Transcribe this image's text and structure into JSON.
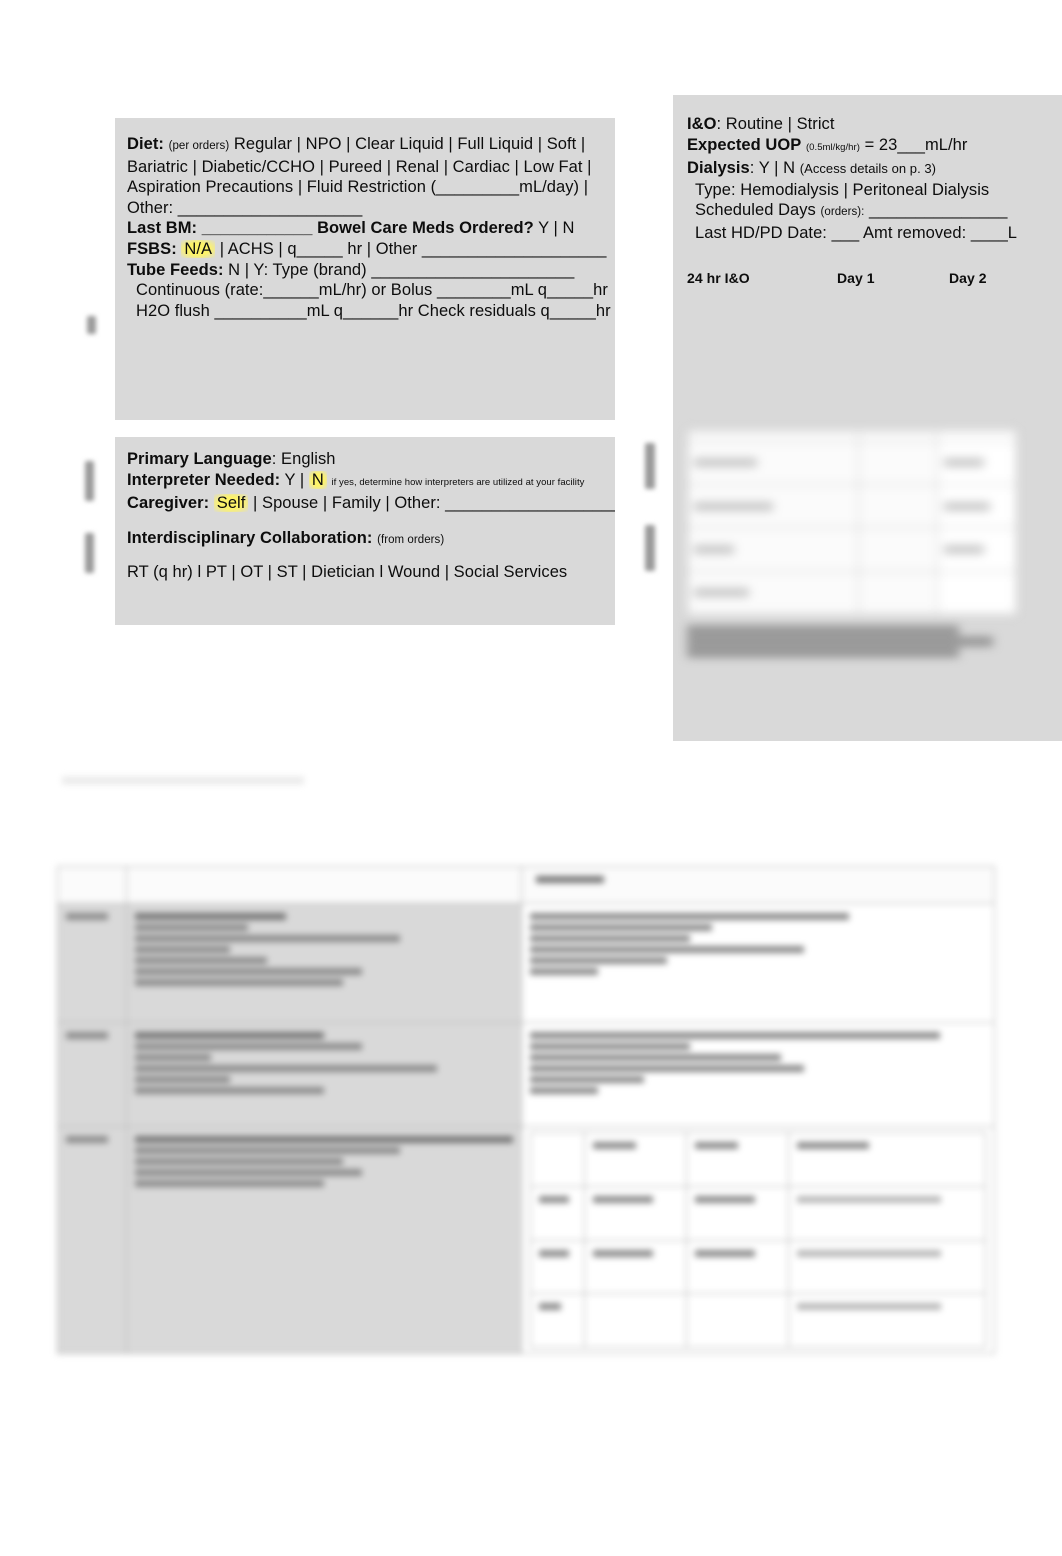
{
  "document": {
    "type": "clinical-nursing-report-sheet",
    "background_color": "#ffffff",
    "panel_color": "#d9d9d9",
    "highlight_color": "#fdf36a",
    "text_color": "#0d0d0d"
  },
  "diet_card": {
    "lines": [
      {
        "label": "Diet",
        "note": "(per orders)",
        "options": "Regular | NPO | Clear Liquid | Full Liquid | Soft |"
      },
      {
        "options": "Bariatric | Diabetic/CCHO | Pureed | Renal | Cardiac | Low Fat  |"
      },
      {
        "options": "Aspiration  Precautions  |  Fluid  Restriction  (_________mL/day)   |"
      },
      {
        "options": "Other:  ____________________"
      }
    ],
    "last_bm_label": "Last BM:",
    "last_bm_blank": "____________",
    "bowel_care_label": "Bowel Care Meds Ordered?",
    "bowel_care_options": "Y | N",
    "fsbs_label": "FSBS:",
    "fsbs_highlight": "N/A",
    "fsbs_rest": "| ACHS | q_____ hr | Other ____________________",
    "tube_feeds_label": "Tube Feeds:",
    "tube_feeds_value": "N | Y: Type (brand) ______________________",
    "tube_feeds_line2": "Continuous (rate:______mL/hr) or Bolus ________mL q_____hr",
    "tube_feeds_line3": "H2O flush __________mL q______hr Check residuals q_____hr"
  },
  "language_card": {
    "primary_language_label": "Primary Language",
    "primary_language_value": ": English",
    "interpreter_label": "Interpreter Needed:",
    "interpreter_y": "Y",
    "interpreter_sep": "|",
    "interpreter_n_highlight": "N",
    "interpreter_note": "if yes, determine how interpreters are utilized at your facility",
    "caregiver_label": "Caregiver",
    "caregiver_highlight": "Self",
    "caregiver_rest": "| Spouse | Family | Other: ___________________",
    "collab_label": "Interdisciplinary Collaboration:",
    "collab_note": "(from orders)",
    "collab_options": "RT (q          hr) l PT | OT | ST | Dietician l Wound | Social Services"
  },
  "io_card": {
    "io_label": "I&O",
    "io_options": ": Routine | Strict",
    "uop_label": "Expected UOP",
    "uop_note": "(0.5ml/kg/hr)",
    "uop_value": "= 23___mL/hr",
    "dialysis_label": "Dialysis",
    "dialysis_options": ": Y | N",
    "dialysis_note": "(Access details on p. 3)",
    "dialysis_type": "Type: Hemodialysis | Peritoneal Dialysis",
    "scheduled_days_label": "Scheduled Days",
    "scheduled_days_note": "(orders):",
    "scheduled_days_blank": "_______________",
    "last_hd_line": "Last HD/PD Date: ___  Amt removed: ____L",
    "table_headers": [
      "24 hr I&O",
      "Day 1",
      "Day 2"
    ],
    "grid_rows": [
      {
        "label": "",
        "day1": "",
        "day2": ""
      },
      {
        "label": "",
        "day1": "",
        "day2": ""
      },
      {
        "label": "",
        "day1": "",
        "day2": ""
      },
      {
        "label": "",
        "day1": "",
        "day2": ""
      }
    ],
    "notes_lines": [
      "",
      "",
      ""
    ]
  },
  "bottom_table": {
    "header_center": "",
    "rows": [
      {
        "num": "",
        "left": "",
        "right": ""
      },
      {
        "num": "",
        "left": "",
        "right": ""
      },
      {
        "num": "",
        "left": "",
        "right": ""
      }
    ]
  }
}
